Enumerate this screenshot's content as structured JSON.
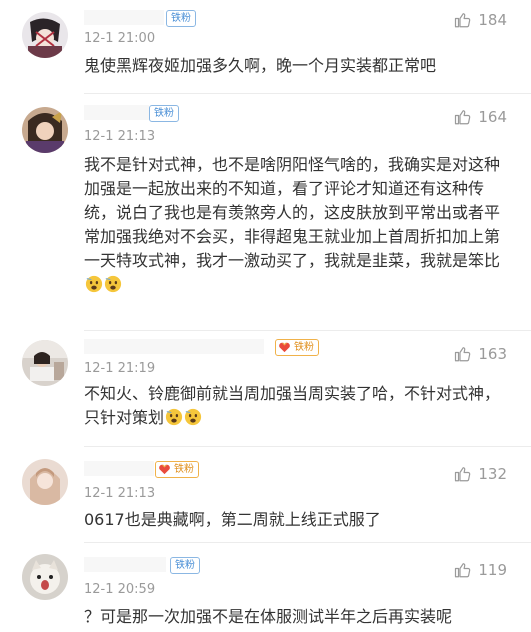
{
  "comments": [
    {
      "badge": "铁粉",
      "badge_style": "blue",
      "time": "12-1 21:00",
      "likes": "184",
      "text": "鬼使黑辉夜姬加强多久啊，晚一个月实装都正常吧",
      "emojis": 0
    },
    {
      "badge": "铁粉",
      "badge_style": "blue",
      "time": "12-1 21:13",
      "likes": "164",
      "text": "我不是针对式神，也不是啥阴阳怪气啥的，我确实是对这种加强是一起放出来的不知道，看了评论才知道还有这种传统，说白了我也是有羡煞旁人的，这皮肤放到平常出或者平常加强我绝对不会买，非得超鬼王就业加上首周折扣加上第一天特攻式神，我才一激动买了，我就是韭菜，我就是笨比",
      "emojis": 2
    },
    {
      "badge": "铁粉",
      "badge_style": "gold",
      "time": "12-1 21:19",
      "likes": "163",
      "text": "不知火、铃鹿御前就当周加强当周实装了哈，不针对式神，只针对策划",
      "emojis": 2
    },
    {
      "badge": "铁粉",
      "badge_style": "gold",
      "time": "12-1 21:13",
      "likes": "132",
      "text": "0617也是典藏啊，第二周就上线正式服了",
      "emojis": 0
    },
    {
      "badge": "铁粉",
      "badge_style": "blue",
      "time": "12-1 20:59",
      "likes": "119",
      "text": "？可是那一次加强不是在体服测试半年之后再实装呢",
      "emojis": 0
    }
  ],
  "icons": {
    "like": "thumbs-up-icon",
    "emoji": "fearful-face-emoji-icon",
    "fan_badge": "heart-badge-icon"
  },
  "colors": {
    "badge_blue": "#4a8fd6",
    "badge_gold": "#e0901d",
    "meta_gray": "#9a9a9a",
    "text": "#333333"
  }
}
